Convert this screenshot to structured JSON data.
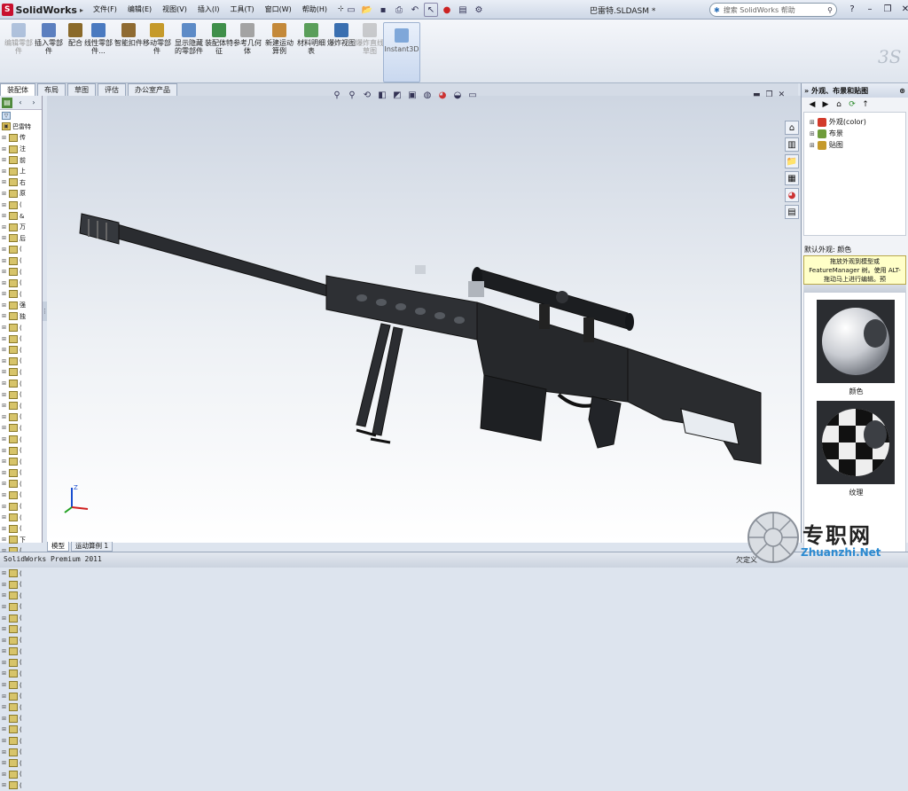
{
  "app": {
    "name": "SolidWorks",
    "doc_title": "巴雷特.SLDASM *"
  },
  "menu": [
    "文件(F)",
    "编辑(E)",
    "视图(V)",
    "插入(I)",
    "工具(T)",
    "窗口(W)",
    "帮助(H)"
  ],
  "search": {
    "placeholder": "搜索 SolidWorks 帮助"
  },
  "ribbon": {
    "buttons": [
      {
        "label": "编辑零部件",
        "enabled": false,
        "color": "#6e8fbf"
      },
      {
        "label": "插入零部件",
        "enabled": true,
        "color": "#5b7fbf"
      },
      {
        "label": "配合",
        "enabled": true,
        "color": "#8a6a2a"
      },
      {
        "label": "线性零部件...",
        "enabled": true,
        "color": "#4a7ac0"
      },
      {
        "label": "智能扣件",
        "enabled": true,
        "color": "#8f6b32"
      },
      {
        "label": "移动零部件",
        "enabled": true,
        "color": "#c59a2b"
      },
      {
        "label": "显示隐藏的零部件",
        "enabled": true,
        "color": "#5d8bc7"
      },
      {
        "label": "装配体特征",
        "enabled": true,
        "color": "#3f8f4a"
      },
      {
        "label": "参考几何体",
        "enabled": true,
        "color": "#a3a3a3"
      },
      {
        "label": "新建运动算例",
        "enabled": true,
        "color": "#c4893a"
      },
      {
        "label": "材料明细表",
        "enabled": true,
        "color": "#5a9e5a"
      },
      {
        "label": "爆炸视图",
        "enabled": true,
        "color": "#3a6fb0"
      },
      {
        "label": "爆炸直线草图",
        "enabled": false,
        "color": "#a0a0a0"
      }
    ],
    "instant3d": "Instant3D"
  },
  "tabs": [
    "装配体",
    "布局",
    "草图",
    "评估",
    "办公室产品"
  ],
  "tree": {
    "root": "巴雷特",
    "rows": [
      "传",
      "注",
      "前",
      "上",
      "右",
      "原",
      "(",
      "&",
      "万",
      "后",
      "(",
      "(",
      "(",
      "(",
      "(",
      "强",
      "独",
      "(",
      "(",
      "(",
      "(",
      "(",
      "(",
      "(",
      "(",
      "(",
      "(",
      "(",
      "(",
      "(",
      "(",
      "(",
      "(",
      "(",
      "(",
      "(",
      "下",
      "(",
      "(",
      "(",
      "(",
      "(",
      "(",
      "(",
      "(",
      "(",
      "(",
      "(",
      "(",
      "(",
      "(",
      "(",
      "(",
      "(",
      "(",
      "(",
      "(",
      "(",
      "("
    ]
  },
  "taskpane": {
    "title": "外观、布景和贴图",
    "items": [
      {
        "label": "外观(color)",
        "color": "#d23a2a"
      },
      {
        "label": "布景",
        "color": "#6f9c3a"
      },
      {
        "label": "贴图",
        "color": "#c59a2b"
      }
    ],
    "appearance_header": "默认外观: 颜色",
    "tooltip": "拖放外观到模型或 FeatureManager 树。使用 ALT-拖动马上进行编辑。预",
    "swatches": [
      {
        "label": "颜色"
      },
      {
        "label": "纹理"
      }
    ]
  },
  "bottom_tabs": [
    "模型",
    "运动算例 1"
  ],
  "status": {
    "left": "SolidWorks Premium 2011",
    "right": "欠定义"
  },
  "watermark": {
    "cn": "专职网",
    "url": "Zhuanzhi.Net"
  }
}
